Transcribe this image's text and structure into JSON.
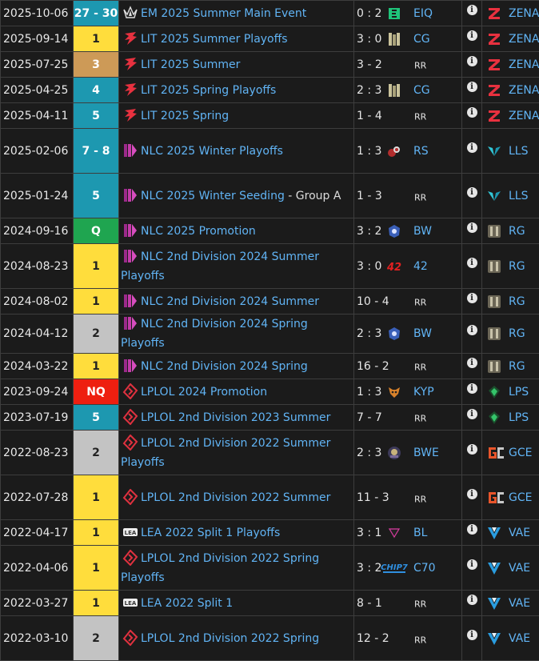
{
  "colors": {
    "place_gold": "#ffdd3c",
    "place_silver": "#c3c3c3",
    "place_bronze": "#cd9a57",
    "place_teal": "#1d98b0",
    "place_green": "#1fa550",
    "place_red": "#ee1f10",
    "link": "#61b4f5"
  },
  "rows": [
    {
      "date": "2025-10-06",
      "place": "27 - 30",
      "place_color": "teal",
      "event": "EM 2025 Summer Main Event",
      "event_suffix": "",
      "event_logo": "em-icon",
      "score": "0 : 2",
      "opponent": "EIQ",
      "opponent_logo": "eiq-icon",
      "team": "ZENA",
      "team_logo": "zena-icon"
    },
    {
      "date": "2025-09-14",
      "place": "1",
      "place_color": "gold",
      "event": "LIT 2025 Summer Playoffs",
      "event_suffix": "",
      "event_logo": "lit-icon",
      "score": "3 : 0",
      "opponent": "CG",
      "opponent_logo": "cg-icon",
      "team": "ZENA",
      "team_logo": "zena-icon"
    },
    {
      "date": "2025-07-25",
      "place": "3",
      "place_color": "bronze",
      "event": "LIT 2025 Summer",
      "event_suffix": "",
      "event_logo": "lit-icon",
      "score": "3 - 2",
      "opponent": "RR",
      "opponent_logo": "",
      "team": "ZENA",
      "team_logo": "zena-icon"
    },
    {
      "date": "2025-04-25",
      "place": "4",
      "place_color": "teal",
      "event": "LIT 2025 Spring Playoffs",
      "event_suffix": "",
      "event_logo": "lit-icon",
      "score": "2 : 3",
      "opponent": "CG",
      "opponent_logo": "cg-icon",
      "team": "ZENA",
      "team_logo": "zena-icon"
    },
    {
      "date": "2025-04-11",
      "place": "5",
      "place_color": "teal",
      "event": "LIT 2025 Spring",
      "event_suffix": "",
      "event_logo": "lit-icon",
      "score": "1 - 4",
      "opponent": "RR",
      "opponent_logo": "",
      "team": "ZENA",
      "team_logo": "zena-icon"
    },
    {
      "date": "2025-02-06",
      "place": "7 - 8",
      "place_color": "teal",
      "event": "NLC 2025 Winter Playoffs",
      "event_suffix": "",
      "event_logo": "nlc-icon",
      "score": "1 : 3",
      "opponent": "RS",
      "opponent_logo": "rs-icon",
      "team": "LLS",
      "team_logo": "lls-icon"
    },
    {
      "date": "2025-01-24",
      "place": "5",
      "place_color": "teal",
      "event": "NLC 2025 Winter Seeding",
      "event_suffix": " - Group A",
      "event_logo": "nlc-icon",
      "score": "1 - 3",
      "opponent": "RR",
      "opponent_logo": "",
      "team": "LLS",
      "team_logo": "lls-icon"
    },
    {
      "date": "2024-09-16",
      "place": "Q",
      "place_color": "green",
      "event": "NLC 2025 Promotion",
      "event_suffix": "",
      "event_logo": "nlc-icon",
      "score": "3 : 2",
      "opponent": "BW",
      "opponent_logo": "bw-icon",
      "team": "RG",
      "team_logo": "rg-icon"
    },
    {
      "date": "2024-08-23",
      "place": "1",
      "place_color": "gold",
      "event": "NLC 2nd Division 2024 Summer Playoffs",
      "event_suffix": "",
      "event_logo": "nlc-icon",
      "score": "3 : 0",
      "opponent": "42",
      "opponent_logo": "fortytwo-icon",
      "team": "RG",
      "team_logo": "rg-icon"
    },
    {
      "date": "2024-08-02",
      "place": "1",
      "place_color": "gold",
      "event": "NLC 2nd Division 2024 Summer",
      "event_suffix": "",
      "event_logo": "nlc-icon",
      "score": "10 - 4",
      "opponent": "RR",
      "opponent_logo": "",
      "team": "RG",
      "team_logo": "rg-icon"
    },
    {
      "date": "2024-04-12",
      "place": "2",
      "place_color": "silver",
      "event": "NLC 2nd Division 2024 Spring Playoffs",
      "event_suffix": "",
      "event_logo": "nlc-icon",
      "score": "2 : 3",
      "opponent": "BW",
      "opponent_logo": "bw-icon",
      "team": "RG",
      "team_logo": "rg-icon"
    },
    {
      "date": "2024-03-22",
      "place": "1",
      "place_color": "gold",
      "event": "NLC 2nd Division 2024 Spring",
      "event_suffix": "",
      "event_logo": "nlc-icon",
      "score": "16 - 2",
      "opponent": "RR",
      "opponent_logo": "",
      "team": "RG",
      "team_logo": "rg-icon"
    },
    {
      "date": "2023-09-24",
      "place": "NQ",
      "place_color": "red",
      "event": "LPLOL 2024 Promotion",
      "event_suffix": "",
      "event_logo": "lplol-icon",
      "score": "1 : 3",
      "opponent": "KYP",
      "opponent_logo": "kyp-icon",
      "team": "LPS",
      "team_logo": "lps-icon"
    },
    {
      "date": "2023-07-19",
      "place": "5",
      "place_color": "teal",
      "event": "LPLOL 2nd Division 2023 Summer",
      "event_suffix": "",
      "event_logo": "lplol-icon",
      "score": "7 - 7",
      "opponent": "RR",
      "opponent_logo": "",
      "team": "LPS",
      "team_logo": "lps-icon"
    },
    {
      "date": "2022-08-23",
      "place": "2",
      "place_color": "silver",
      "event": "LPLOL 2nd Division 2022 Summer Playoffs",
      "event_suffix": "",
      "event_logo": "lplol-icon",
      "score": "2 : 3",
      "opponent": "BWE",
      "opponent_logo": "bwe-icon",
      "team": "GCE",
      "team_logo": "gce-icon"
    },
    {
      "date": "2022-07-28",
      "place": "1",
      "place_color": "gold",
      "event": "LPLOL 2nd Division 2022 Summer",
      "event_suffix": "",
      "event_logo": "lplol-icon",
      "score": "11 - 3",
      "opponent": "RR",
      "opponent_logo": "",
      "team": "GCE",
      "team_logo": "gce-icon"
    },
    {
      "date": "2022-04-17",
      "place": "1",
      "place_color": "gold",
      "event": "LEA 2022 Split 1 Playoffs",
      "event_suffix": "",
      "event_logo": "lea-icon",
      "score": "3 : 1",
      "opponent": "BL",
      "opponent_logo": "bl-icon",
      "team": "VAE",
      "team_logo": "vae-icon"
    },
    {
      "date": "2022-04-06",
      "place": "1",
      "place_color": "gold",
      "event": "LPLOL 2nd Division 2022 Spring Playoffs",
      "event_suffix": "",
      "event_logo": "lplol-icon",
      "score": "3 : 2",
      "opponent": "C70",
      "opponent_logo": "chip7-icon",
      "team": "VAE",
      "team_logo": "vae-icon"
    },
    {
      "date": "2022-03-27",
      "place": "1",
      "place_color": "gold",
      "event": "LEA 2022 Split 1",
      "event_suffix": "",
      "event_logo": "lea-icon",
      "score": "8 - 1",
      "opponent": "RR",
      "opponent_logo": "",
      "team": "VAE",
      "team_logo": "vae-icon"
    },
    {
      "date": "2022-03-10",
      "place": "2",
      "place_color": "silver",
      "event": "LPLOL 2nd Division 2022 Spring",
      "event_suffix": "",
      "event_logo": "lplol-icon",
      "score": "12 - 2",
      "opponent": "RR",
      "opponent_logo": "",
      "team": "VAE",
      "team_logo": "vae-icon"
    }
  ]
}
